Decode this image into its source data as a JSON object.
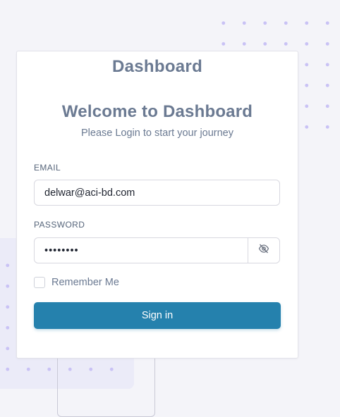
{
  "brand": {
    "title": "Dashboard"
  },
  "login": {
    "heading": "Welcome to Dashboard",
    "subtitle": "Please Login to start your journey",
    "email": {
      "label": "EMAIL",
      "value": "delwar@aci-bd.com"
    },
    "password": {
      "label": "PASSWORD",
      "value": "••••••••",
      "toggle_icon": "eye-slash-icon"
    },
    "remember": {
      "label": "Remember Me",
      "checked": false
    },
    "submit_label": "Sign in"
  },
  "colors": {
    "accent": "#2581ad",
    "heading": "#6b7a92",
    "decoration_dots": "#c9c2f5",
    "page_background": "#f4f4f9"
  }
}
